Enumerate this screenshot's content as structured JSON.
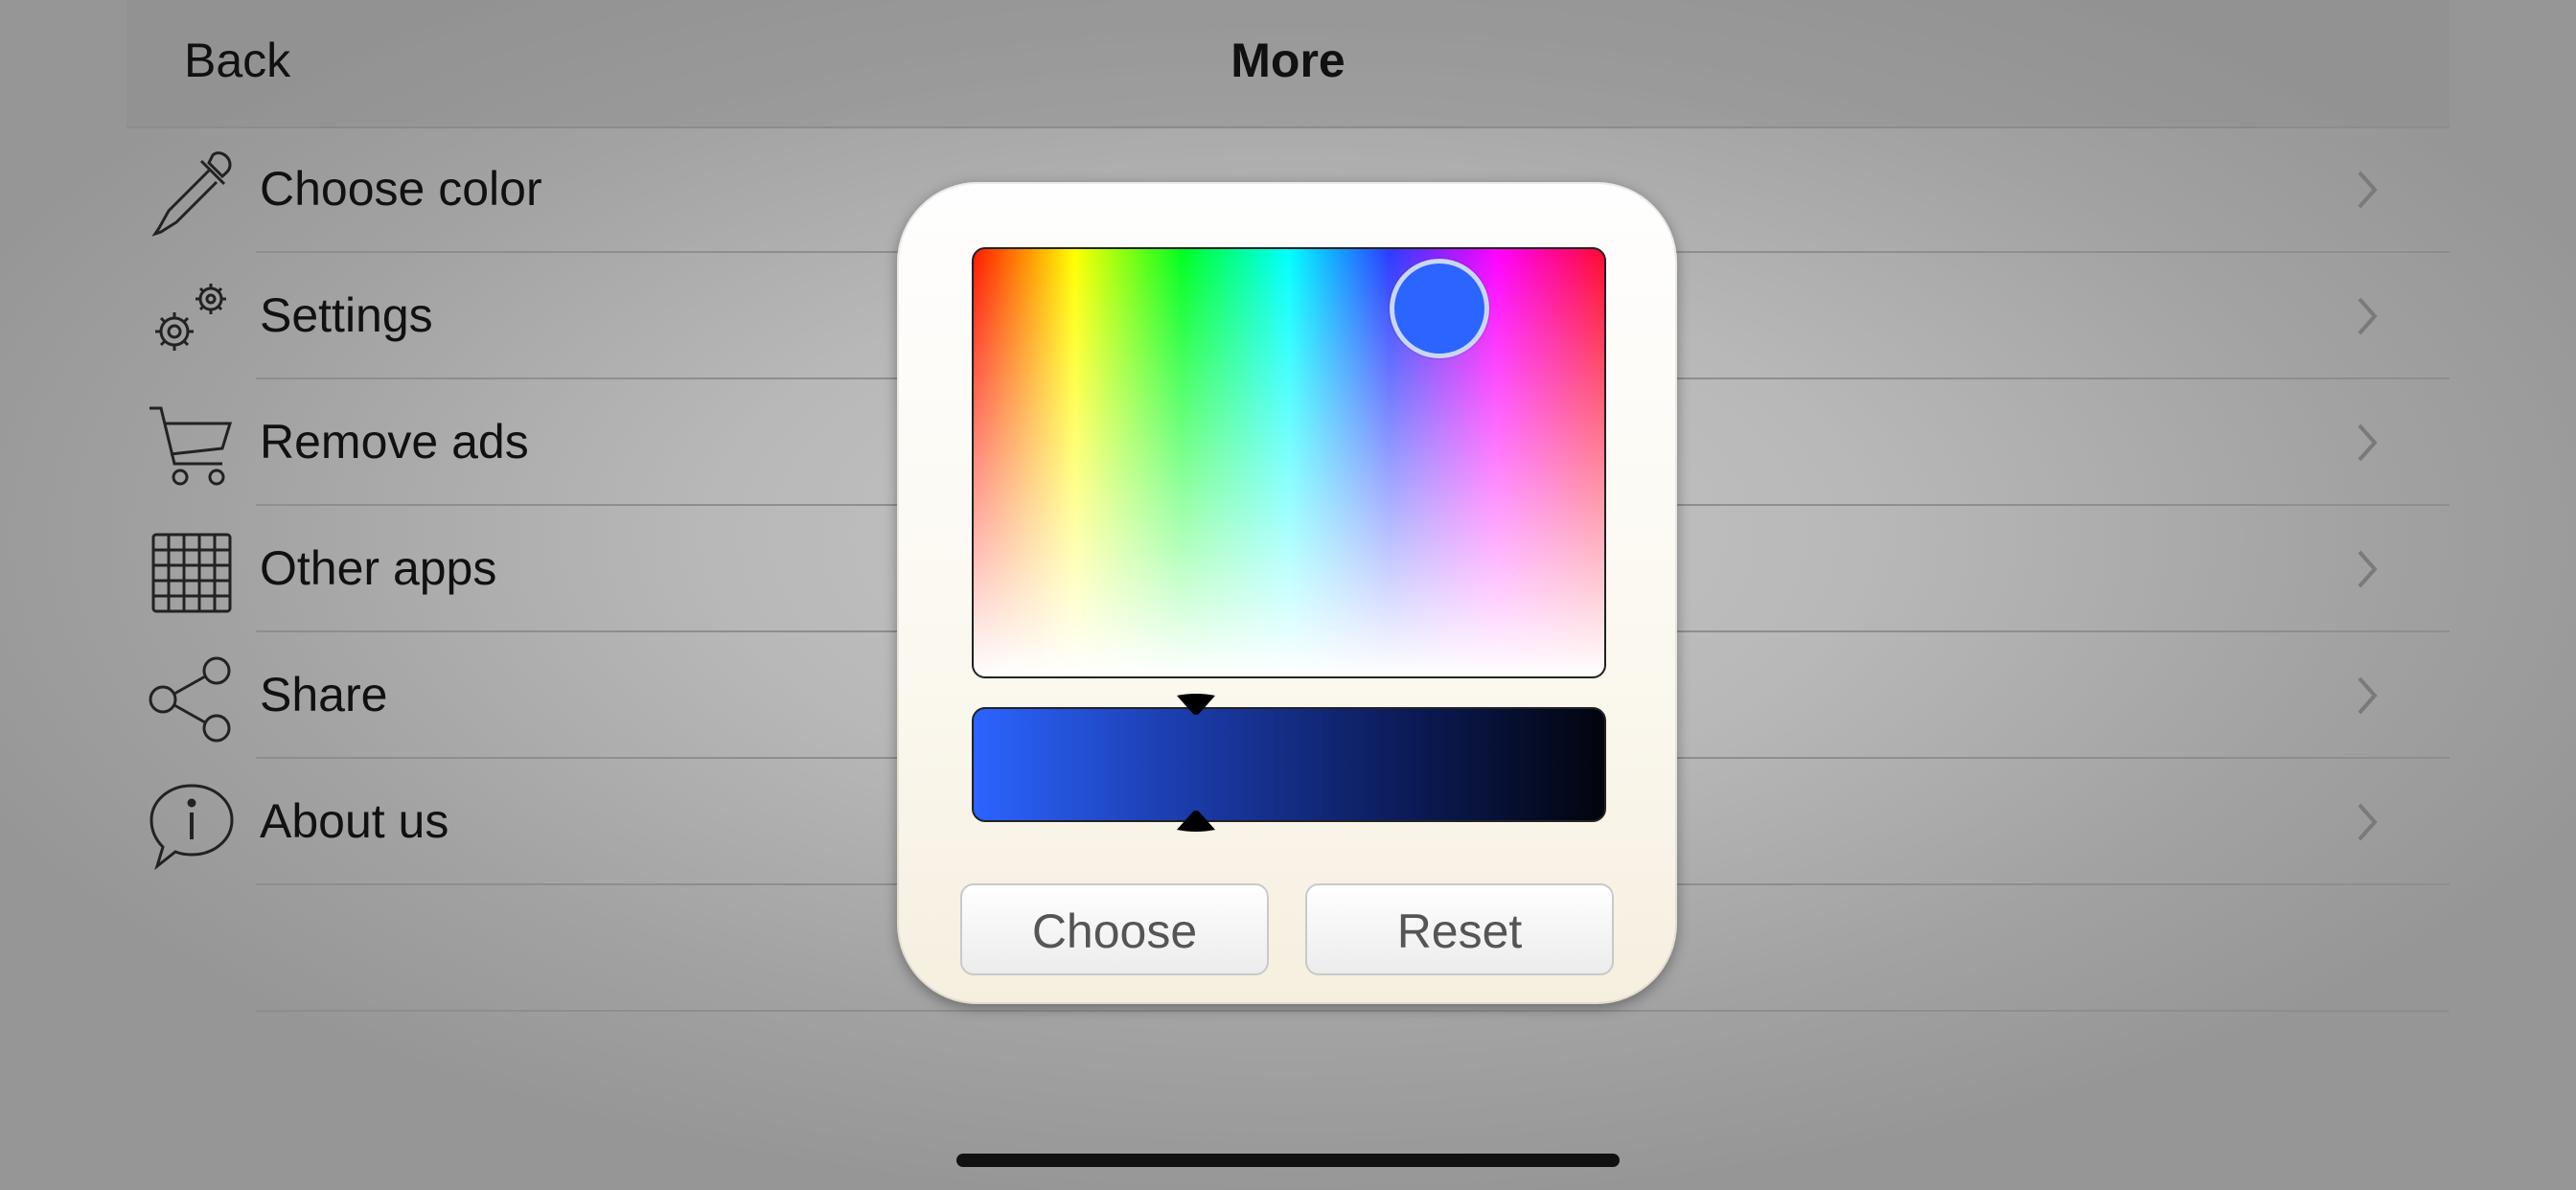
{
  "navbar": {
    "back_label": "Back",
    "title": "More"
  },
  "menu": [
    {
      "label": "Choose color",
      "icon": "eyedropper-icon"
    },
    {
      "label": "Settings",
      "icon": "gears-icon"
    },
    {
      "label": "Remove ads",
      "icon": "cart-icon"
    },
    {
      "label": "Other apps",
      "icon": "grid-icon"
    },
    {
      "label": "Share",
      "icon": "share-icon"
    },
    {
      "label": "About us",
      "icon": "info-bubble-icon"
    }
  ],
  "color_picker": {
    "selected_color": "#2B64FF",
    "choose_label": "Choose",
    "reset_label": "Reset"
  }
}
